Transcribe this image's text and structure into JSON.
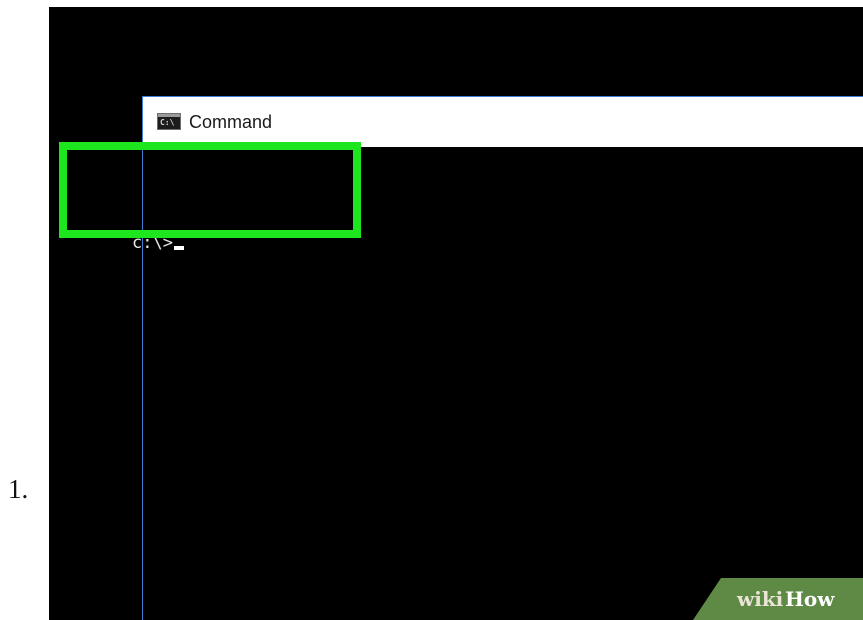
{
  "step": {
    "number": "1."
  },
  "window": {
    "title": "Command",
    "icon_glyph": "C:\\",
    "icon_name": "command-prompt-icon"
  },
  "console": {
    "prompt": "c:\\>"
  },
  "highlight": {
    "color": "#1ee61e"
  },
  "watermark": {
    "part1": "wiki",
    "part2": "How"
  }
}
